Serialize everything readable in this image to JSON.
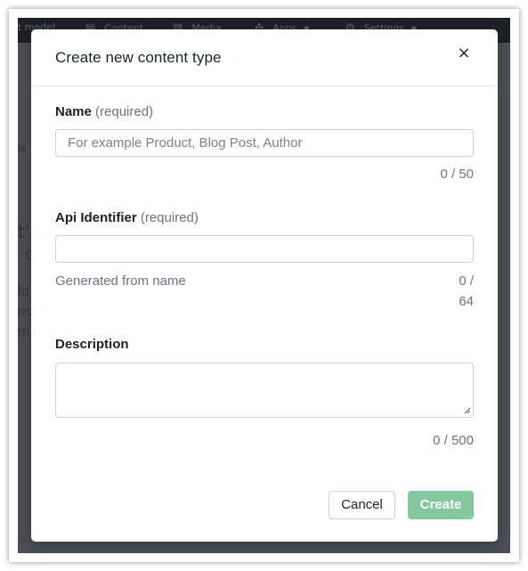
{
  "background": {
    "nav": {
      "items": [
        {
          "label": "t model",
          "icon": ""
        },
        {
          "label": "Content",
          "icon": "document-icon"
        },
        {
          "label": "Media",
          "icon": "image-icon"
        },
        {
          "label": "Apps",
          "icon": "puzzle-icon"
        },
        {
          "label": "Settings",
          "icon": "gear-icon"
        }
      ]
    },
    "fragments": [
      "w",
      "t's",
      "G",
      "ld",
      "nce",
      "m"
    ]
  },
  "modal": {
    "title": "Create new content type",
    "close_symbol": "×",
    "name_field": {
      "label": "Name",
      "required_text": "(required)",
      "placeholder": "For example Product, Blog Post, Author",
      "value": "",
      "counter": "0 / 50"
    },
    "api_field": {
      "label": "Api Identifier",
      "required_text": "(required)",
      "value": "",
      "hint": "Generated from name",
      "counter_line1": "0 /",
      "counter_line2": "64"
    },
    "description_field": {
      "label": "Description",
      "value": "",
      "counter": "0 / 500"
    },
    "buttons": {
      "cancel": "Cancel",
      "create": "Create"
    }
  },
  "colors": {
    "primary_disabled": "#84c8a0",
    "backdrop": "#4b4f55",
    "nav": "#1d2126"
  }
}
